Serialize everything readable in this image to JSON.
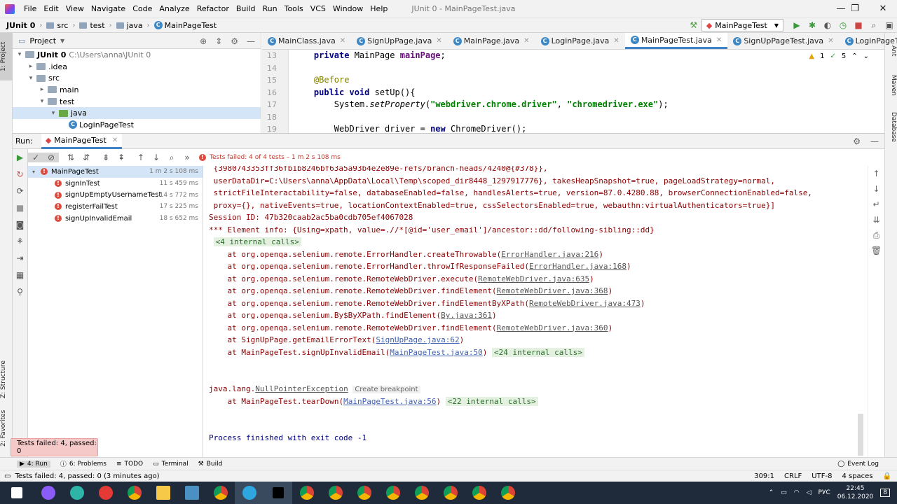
{
  "menu": {
    "items": [
      "File",
      "Edit",
      "View",
      "Navigate",
      "Code",
      "Analyze",
      "Refactor",
      "Build",
      "Run",
      "Tools",
      "VCS",
      "Window",
      "Help"
    ],
    "window_title": "JUnit 0 - MainPageTest.java"
  },
  "breadcrumb": [
    "JUnit 0",
    "src",
    "test",
    "java",
    "MainPageTest"
  ],
  "run_config": "MainPageTest",
  "project": {
    "header": "Project",
    "tree": [
      {
        "label": "JUnit 0",
        "path": "C:\\Users\\anna\\JUnit 0",
        "depth": 0,
        "arrow": "▾",
        "kind": "folder"
      },
      {
        "label": ".idea",
        "depth": 1,
        "arrow": "▸",
        "kind": "folder"
      },
      {
        "label": "src",
        "depth": 1,
        "arrow": "▾",
        "kind": "folder"
      },
      {
        "label": "main",
        "depth": 2,
        "arrow": "▸",
        "kind": "folder"
      },
      {
        "label": "test",
        "depth": 2,
        "arrow": "▾",
        "kind": "folder"
      },
      {
        "label": "java",
        "depth": 3,
        "arrow": "▾",
        "kind": "folder-green"
      },
      {
        "label": "LoginPageTest",
        "depth": 4,
        "arrow": "",
        "kind": "class"
      }
    ]
  },
  "tabs": [
    {
      "label": "MainClass.java",
      "active": false
    },
    {
      "label": "SignUpPage.java",
      "active": false
    },
    {
      "label": "MainPage.java",
      "active": false
    },
    {
      "label": "LoginPage.java",
      "active": false
    },
    {
      "label": "MainPageTest.java",
      "active": true
    },
    {
      "label": "SignUpPageTest.java",
      "active": false
    },
    {
      "label": "LoginPageTest.java",
      "active": false
    }
  ],
  "editor": {
    "line_numbers": [
      "13",
      "14",
      "15",
      "16",
      "17",
      "18",
      "19"
    ],
    "inspection_warnings": "1",
    "inspection_ok": "5"
  },
  "run_panel": {
    "label": "Run:",
    "tab": "MainPageTest",
    "status": "Tests failed: 4 of 4 tests – 1 m 2 s 108 ms",
    "tests": [
      {
        "name": "MainPageTest",
        "time": "1 m 2 s 108 ms",
        "root": true
      },
      {
        "name": "signInTest",
        "time": "11 s 459 ms"
      },
      {
        "name": "signUpEmptyUsernameTest",
        "time": "14 s 772 ms"
      },
      {
        "name": "registerFailTest",
        "time": "17 s 225 ms"
      },
      {
        "name": "signUpInvalidEmail",
        "time": "18 s 652 ms"
      }
    ]
  },
  "console": {
    "line1": " {3980743353ff36fb1b8246bf63a5a93b4e2e89e-refs/branch-heads/4240@{#378}},",
    "line2": " userDataDir=C:\\Users\\anna\\AppData\\Local\\Temp\\scoped_dir8448_1297917776}, takesHeapSnapshot=true, pageLoadStrategy=normal,",
    "line3": " strictFileInteractability=false, databaseEnabled=false, handlesAlerts=true, version=87.0.4280.88, browserConnectionEnabled=false,",
    "line4": " proxy={}, nativeEvents=true, locationContextEnabled=true, cssSelectorsEnabled=true, webauthn:virtualAuthenticators=true}]",
    "session": "Session ID: 47b320caab2ac5ba0cdb705ef4067028",
    "element_info": "*** Element info: {Using=xpath, value=.//*[@id='user_email']/ancestor::dd/following-sibling::dd}",
    "internal4": "<4 internal calls>",
    "frames": [
      {
        "pre": "at org.openqa.selenium.remote.ErrorHandler.createThrowable(",
        "link": "ErrorHandler.java:216",
        "post": ")"
      },
      {
        "pre": "at org.openqa.selenium.remote.ErrorHandler.throwIfResponseFailed(",
        "link": "ErrorHandler.java:168",
        "post": ")"
      },
      {
        "pre": "at org.openqa.selenium.remote.RemoteWebDriver.execute(",
        "link": "RemoteWebDriver.java:635",
        "post": ")"
      },
      {
        "pre": "at org.openqa.selenium.remote.RemoteWebDriver.findElement(",
        "link": "RemoteWebDriver.java:368",
        "post": ")"
      },
      {
        "pre": "at org.openqa.selenium.remote.RemoteWebDriver.findElementByXPath(",
        "link": "RemoteWebDriver.java:473",
        "post": ")"
      },
      {
        "pre": "at org.openqa.selenium.By$ByXPath.findElement(",
        "link": "By.java:361",
        "post": ")"
      },
      {
        "pre": "at org.openqa.selenium.remote.RemoteWebDriver.findElement(",
        "link": "RemoteWebDriver.java:360",
        "post": ")"
      }
    ],
    "frame_signup_pre": "at SignUpPage.getEmailErrorText(",
    "frame_signup_link": "SignUpPage.java:62",
    "frame_main_pre": "at MainPageTest.signUpInvalidEmail(",
    "frame_main_link": "MainPageTest.java:50",
    "internal24": "<24 internal calls>",
    "npe_prefix": "java.lang.",
    "npe": "NullPointerException",
    "create_breakpoint": "Create breakpoint",
    "teardown_pre": "at MainPageTest.tearDown(",
    "teardown_link": "MainPageTest.java:56",
    "internal22": "<22 internal calls>",
    "finished": "Process finished with exit code -1"
  },
  "toast": "Tests failed: 4, passed: 0",
  "bottom_tabs": [
    "4: Run",
    "6: Problems",
    "TODO",
    "Terminal",
    "Build"
  ],
  "event_log": "Event Log",
  "status": {
    "message": "Tests failed: 4, passed: 0 (3 minutes ago)",
    "position": "309:1",
    "line_sep": "CRLF",
    "encoding": "UTF-8",
    "indent": "4 spaces"
  },
  "left_strip": [
    "1: Project",
    "Z: Structure",
    "2: Favorites"
  ],
  "right_strip": [
    "Ant",
    "Maven",
    "Database"
  ],
  "taskbar": {
    "lang": "РУС",
    "time": "22:45",
    "date": "06.12.2020",
    "notifications": "8"
  }
}
